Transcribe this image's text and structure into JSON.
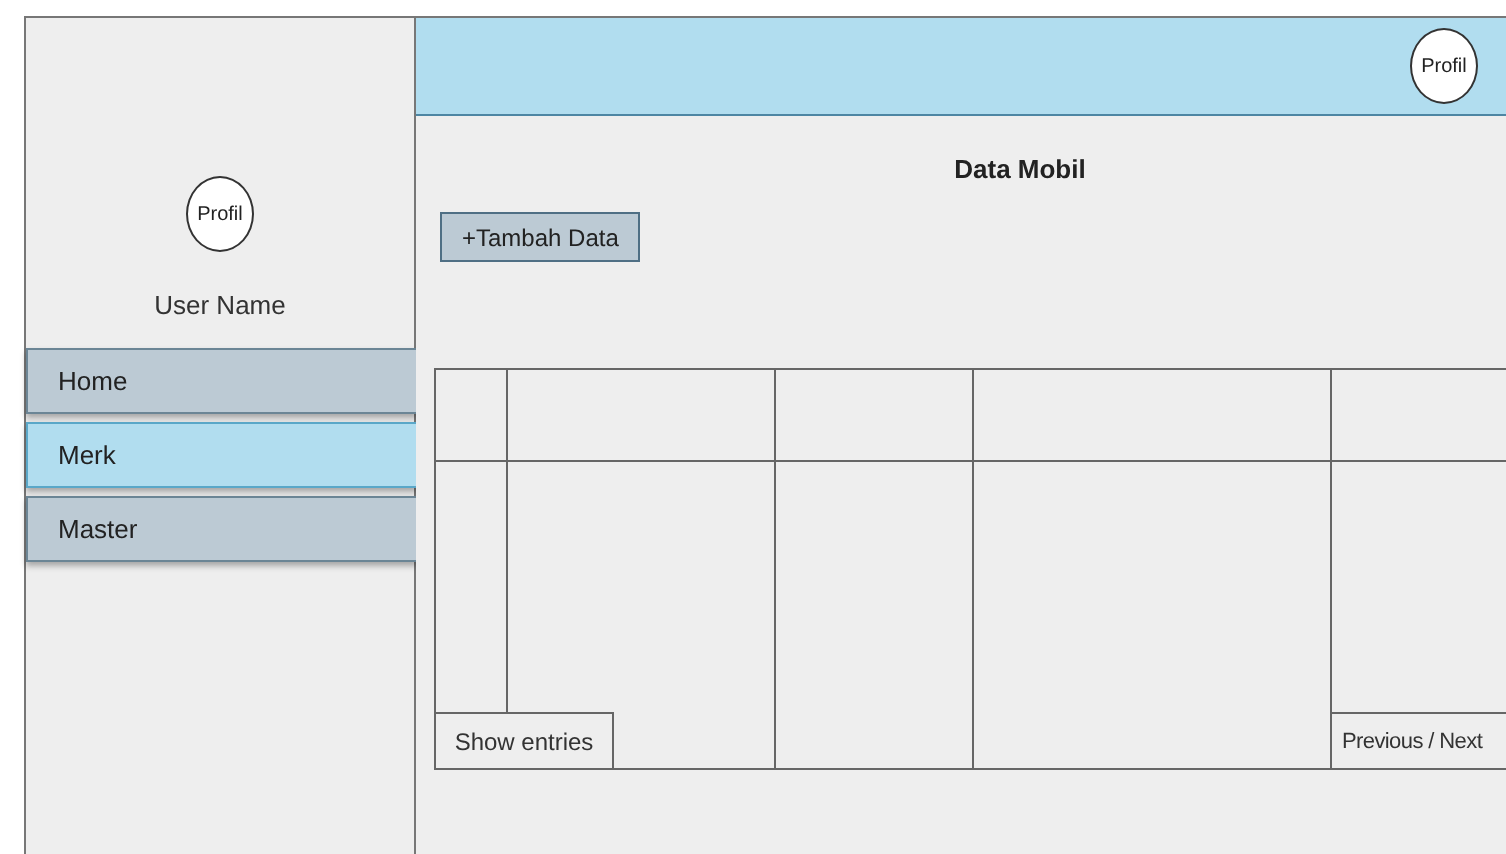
{
  "sidebar": {
    "profile": "Profil",
    "user_name": "User Name",
    "items": [
      {
        "label": "Home",
        "selected": false
      },
      {
        "label": "Merk",
        "selected": true
      },
      {
        "label": "Master",
        "selected": false
      }
    ]
  },
  "header": {
    "profile": "Profil"
  },
  "title": "Data Mobil",
  "add_button": "+Tambah Data",
  "table": {
    "show_entries": "Show entries",
    "pagination": "Previous / Next"
  }
}
